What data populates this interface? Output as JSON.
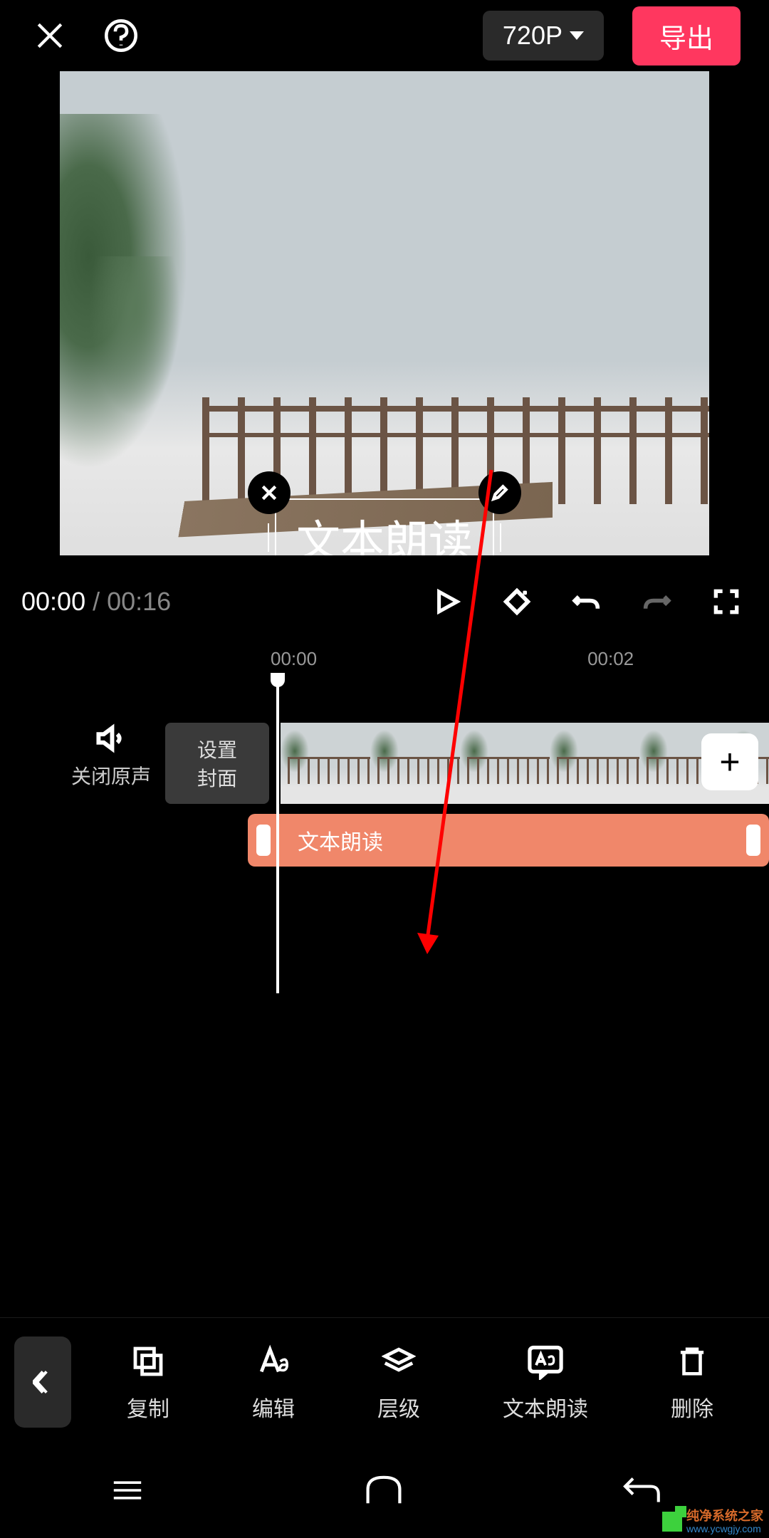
{
  "header": {
    "resolution": "720P",
    "export_label": "导出"
  },
  "preview": {
    "text_overlay": "文本朗读"
  },
  "playback": {
    "current_time": "00:00",
    "separator": "/",
    "total_time": "00:16"
  },
  "timeline": {
    "ruler": [
      "00:00",
      "00:02"
    ],
    "sound_toggle_label": "关闭原声",
    "cover_line1": "设置",
    "cover_line2": "封面",
    "text_clip_label": "文本朗读"
  },
  "toolbar": {
    "items": [
      {
        "label": "复制",
        "icon": "copy"
      },
      {
        "label": "编辑",
        "icon": "text"
      },
      {
        "label": "层级",
        "icon": "layers"
      },
      {
        "label": "文本朗读",
        "icon": "tts"
      },
      {
        "label": "删除",
        "icon": "delete"
      }
    ]
  },
  "watermark": {
    "line1": "纯净系统之家",
    "line2": "www.ycwgjy.com"
  }
}
